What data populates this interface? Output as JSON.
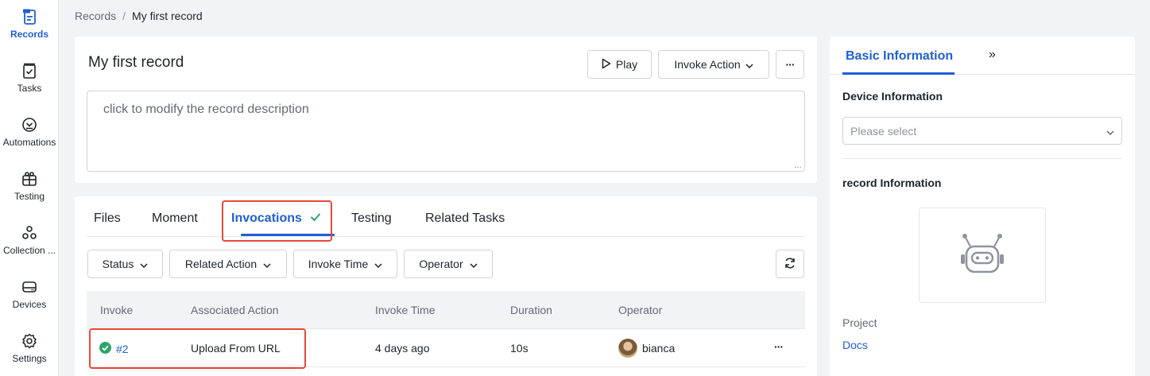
{
  "nav": {
    "items": [
      {
        "label": "Records",
        "icon": "records-icon",
        "active": true
      },
      {
        "label": "Tasks",
        "icon": "tasks-icon"
      },
      {
        "label": "Automations",
        "icon": "automations-icon"
      },
      {
        "label": "Testing",
        "icon": "testing-icon"
      },
      {
        "label": "Collection ...",
        "icon": "collection-icon"
      },
      {
        "label": "Devices",
        "icon": "devices-icon"
      },
      {
        "label": "Settings",
        "icon": "settings-icon"
      }
    ]
  },
  "breadcrumb": {
    "root": "Records",
    "sep": "/",
    "current": "My first record"
  },
  "record": {
    "title": "My first record",
    "play_label": "Play",
    "invoke_label": "Invoke Action",
    "more_label": "···",
    "description_placeholder": "click to modify the record description"
  },
  "tabs": {
    "files": "Files",
    "moment": "Moment",
    "invocations": "Invocations",
    "testing": "Testing",
    "related_tasks": "Related Tasks"
  },
  "filters": {
    "status": "Status",
    "related_action": "Related Action",
    "invoke_time": "Invoke Time",
    "operator": "Operator"
  },
  "table": {
    "headers": [
      "Invoke",
      "Associated Action",
      "Invoke Time",
      "Duration",
      "Operator"
    ],
    "rows": [
      {
        "invoke": "#2",
        "action": "Upload From URL",
        "time": "4 days ago",
        "duration": "10s",
        "operator": "bianca",
        "more": "···"
      }
    ]
  },
  "panel": {
    "tab": "Basic Information",
    "collapse": "»",
    "device_title": "Device Information",
    "device_placeholder": "Please select",
    "record_title": "record Information",
    "project_label": "Project",
    "project_value": "Docs"
  },
  "colors": {
    "accent": "#1f5fd6",
    "success": "#2ea36b",
    "highlight": "#e8483a"
  }
}
